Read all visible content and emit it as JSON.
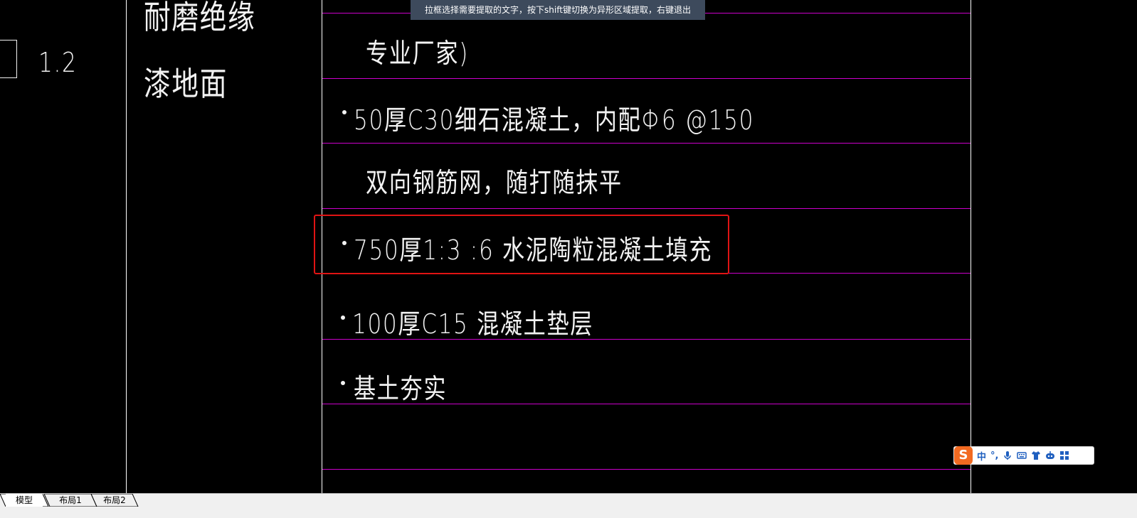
{
  "tooltip": {
    "text": "拉框选择需要提取的文字，按下shift键切换为异形区域提取，右键退出"
  },
  "left_column": {
    "number": "1.2",
    "name_line1": "耐磨绝缘",
    "name_line2": "漆地面"
  },
  "layers": [
    {
      "text": "专业厂家)",
      "bullet": false
    },
    {
      "text": "50厚C30细石混凝土，内配Φ6 @150",
      "bullet": true
    },
    {
      "text": "双向钢筋网，随打随抹平",
      "bullet": false
    },
    {
      "text": "750厚1:3 :6 水泥陶粒混凝土填充",
      "bullet": true
    },
    {
      "text": "100厚C15 混凝土垫层",
      "bullet": true
    },
    {
      "text": "基土夯实",
      "bullet": true
    }
  ],
  "ime": {
    "logo": "S",
    "mode": "中",
    "punct": "°,",
    "icons": [
      "microphone-icon",
      "keyboard-icon",
      "shirt-icon",
      "robot-icon",
      "grid-icon"
    ]
  },
  "tabs": [
    {
      "label": "模型",
      "active": true
    },
    {
      "label": "布局1",
      "active": false
    },
    {
      "label": "布局2",
      "active": false
    }
  ],
  "colors": {
    "canvas": "#000000",
    "grid_line": "#cc00cc",
    "highlight": "#e01414",
    "text": "#f2f2f2"
  }
}
